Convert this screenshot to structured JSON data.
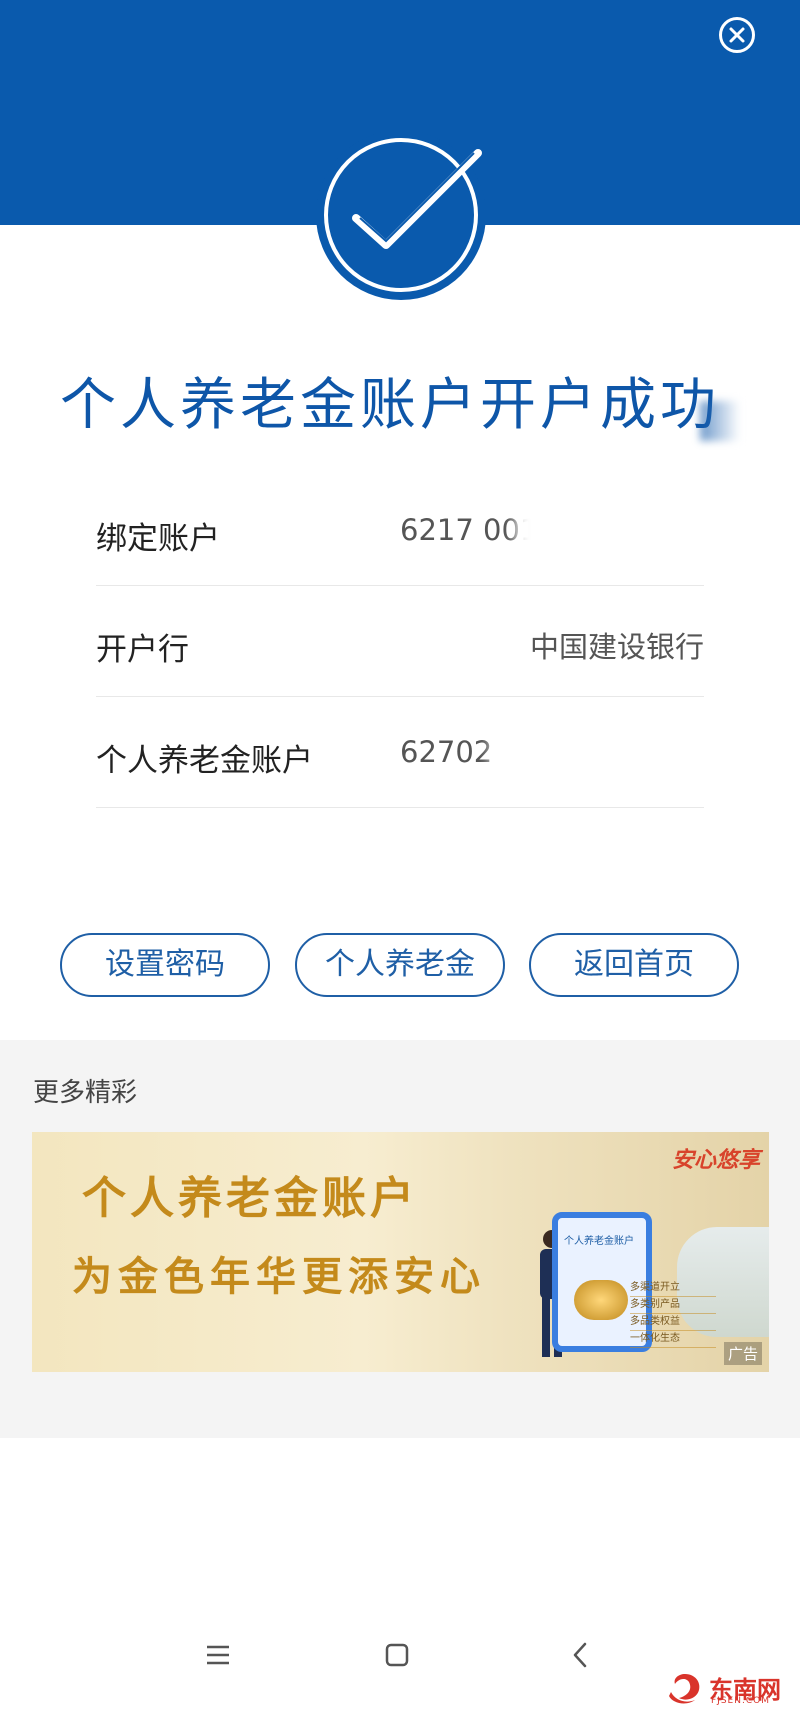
{
  "header": {
    "bg_color": "#0a5aad",
    "close_icon": "close-circle-icon",
    "check_icon": "check-circle-icon"
  },
  "title": "个人养老金账户开户成功",
  "info_rows": [
    {
      "label": "绑定账户",
      "value": "6217 001"
    },
    {
      "label": "开户行",
      "value": "中国建设银行"
    },
    {
      "label": "个人养老金账户",
      "value": "62702"
    }
  ],
  "buttons": [
    {
      "label": "设置密码"
    },
    {
      "label": "个人养老金"
    },
    {
      "label": "返回首页"
    }
  ],
  "more": {
    "title": "更多精彩",
    "banner": {
      "line1": "个人养老金账户",
      "line2": "为金色年华更添安心",
      "logo_text": "安心悠享",
      "phone_text": "个人养老金账户",
      "features": [
        "多渠道开立",
        "多类别产品",
        "多品类权益",
        "一体化生态"
      ],
      "ad_label": "广告"
    }
  },
  "watermark": {
    "text": "东南网",
    "sub": "FJSEN.COM"
  }
}
